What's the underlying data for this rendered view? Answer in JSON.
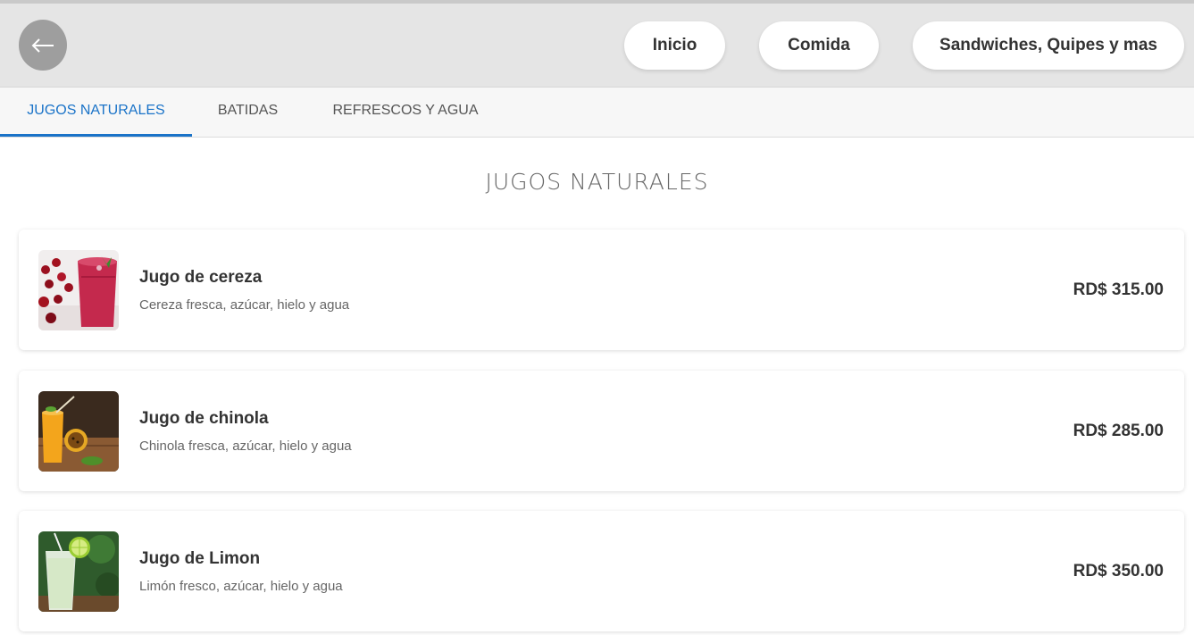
{
  "header": {
    "back_icon": "arrow-left-icon",
    "nav": {
      "inicio": "Inicio",
      "comida": "Comida",
      "sandwiches": "Sandwiches, Quipes y mas"
    }
  },
  "tabs": {
    "active": "JUGOS NATURALES",
    "items": [
      "JUGOS NATURALES",
      "BATIDAS",
      "REFRESCOS Y AGUA"
    ]
  },
  "section": {
    "title": "JUGOS NATURALES"
  },
  "items": [
    {
      "name": "Jugo de cereza",
      "description": "Cereza fresca, azúcar, hielo y agua",
      "price": "RD$ 315.00",
      "image": "cherry-juice-photo"
    },
    {
      "name": "Jugo de chinola",
      "description": "Chinola fresca, azúcar, hielo y agua",
      "price": "RD$ 285.00",
      "image": "passion-fruit-juice-photo"
    },
    {
      "name": "Jugo de Limon",
      "description": "Limón fresco, azúcar, hielo y agua",
      "price": "RD$ 350.00",
      "image": "lemonade-photo"
    }
  ],
  "colors": {
    "accent": "#1a73c8",
    "header_bg": "#e5e5e5",
    "back_button": "#9e9e9e"
  }
}
